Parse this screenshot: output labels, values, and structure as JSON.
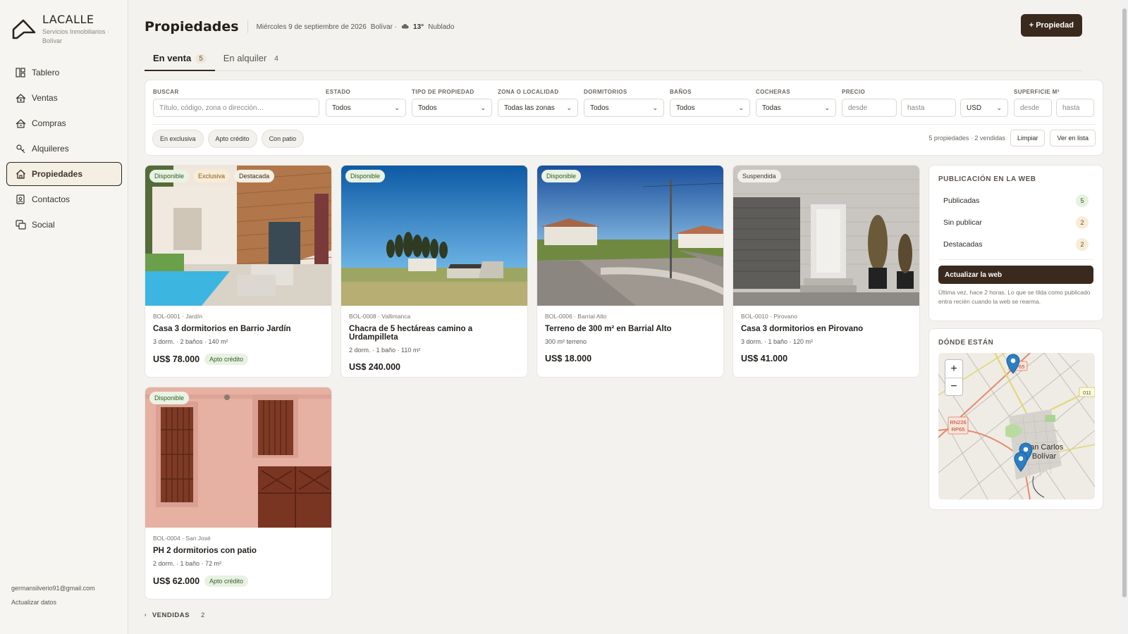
{
  "brand": {
    "name": "LACALLE",
    "subtitle": "Servicios Inmobiliarios · Bolívar"
  },
  "sidebar": {
    "items": [
      {
        "label": "Tablero",
        "icon": "dashboard-icon"
      },
      {
        "label": "Ventas",
        "icon": "sales-icon"
      },
      {
        "label": "Compras",
        "icon": "purchases-icon"
      },
      {
        "label": "Alquileres",
        "icon": "rentals-icon"
      },
      {
        "label": "Propiedades",
        "icon": "home-icon",
        "active": true
      },
      {
        "label": "Contactos",
        "icon": "contacts-icon"
      },
      {
        "label": "Social",
        "icon": "social-icon"
      }
    ],
    "email": "germansilverio91@gmail.com",
    "update_link": "Actualizar datos"
  },
  "header": {
    "title": "Propiedades",
    "date": "Miércoles 9 de septiembre de 2026",
    "location": "Bolívar ·",
    "temperature": "13°",
    "weather": "Nublado",
    "add_button": "+ Propiedad"
  },
  "tabs": [
    {
      "label": "En venta",
      "count": "5",
      "active": true
    },
    {
      "label": "En alquiler",
      "count": "4"
    }
  ],
  "filters": {
    "search": {
      "label": "BUSCAR",
      "placeholder": "Título, código, zona o dirección…"
    },
    "estado": {
      "label": "ESTADO",
      "value": "Todos"
    },
    "tipo": {
      "label": "TIPO DE PROPIEDAD",
      "value": "Todos"
    },
    "zona": {
      "label": "ZONA O LOCALIDAD",
      "value": "Todas las zonas"
    },
    "dormitorios": {
      "label": "DORMITORIOS",
      "value": "Todos"
    },
    "banos": {
      "label": "BAÑOS",
      "value": "Todos"
    },
    "cocheras": {
      "label": "COCHERAS",
      "value": "Todas"
    },
    "precio": {
      "label": "PRECIO",
      "from": "desde",
      "to": "hasta",
      "currency": "USD"
    },
    "superficie": {
      "label": "SUPERFICIE M²",
      "from": "desde",
      "to": "hasta"
    },
    "chips": [
      "En exclusiva",
      "Apto crédito",
      "Con patio"
    ],
    "summary": "5 propiedades · 2 vendidas",
    "clear_button": "Limpiar",
    "list_button": "Ver en lista"
  },
  "properties": [
    {
      "code": "BOL-0001 · Jardín",
      "title": "Casa 3 dormitorios en Barrio Jardín",
      "specs": "3 dorm. · 2 baños · 140 m²",
      "price": "US$ 78.000",
      "credit": "Apto crédito",
      "badges": [
        "Disponible",
        "Exclusiva",
        "Destacada"
      ]
    },
    {
      "code": "BOL-0008 · Vallimanca",
      "title": "Chacra de 5 hectáreas camino a Urdampilleta",
      "specs": "2 dorm. · 1 baño · 110 m²",
      "price": "US$ 240.000",
      "badges": [
        "Disponible"
      ]
    },
    {
      "code": "BOL-0006 · Barrial Alto",
      "title": "Terreno de 300 m² en Barrial Alto",
      "specs": "300 m² terreno",
      "price": "US$ 18.000",
      "badges": [
        "Disponible"
      ]
    },
    {
      "code": "BOL-0010 · Pirovano",
      "title": "Casa 3 dormitorios en Pirovano",
      "specs": "3 dorm. · 1 baño · 120 m²",
      "price": "US$ 41.000",
      "badges": [
        "Suspendida"
      ]
    },
    {
      "code": "BOL-0004 · San José",
      "title": "PH 2 dormitorios con patio",
      "specs": "2 dorm. · 1 baño · 72 m²",
      "price": "US$ 62.000",
      "credit": "Apto crédito",
      "badges": [
        "Disponible"
      ]
    }
  ],
  "web_panel": {
    "title": "PUBLICACIÓN EN LA WEB",
    "rows": [
      {
        "label": "Publicadas",
        "count": "5"
      },
      {
        "label": "Sin publicar",
        "count": "2"
      },
      {
        "label": "Destacadas",
        "count": "2"
      }
    ],
    "button": "Actualizar la web",
    "note": "Última vez, hace 2 horas. Lo que se tilda como publicado entra recién cuando la web se rearma."
  },
  "map_panel": {
    "title": "DÓNDE ESTÁN",
    "labels": {
      "road1": "RP65",
      "road2": "011",
      "road3a": "RN226",
      "road3b": "RP65",
      "city1": "San Carlos",
      "city2": "Bolívar"
    },
    "zoom_in": "+",
    "zoom_out": "−"
  },
  "sold": {
    "label": "VENDIDAS",
    "count": "2"
  },
  "colors": {
    "accent": "#3a2a1d",
    "available": "#2f5a24",
    "background": "#f3f2ef"
  }
}
